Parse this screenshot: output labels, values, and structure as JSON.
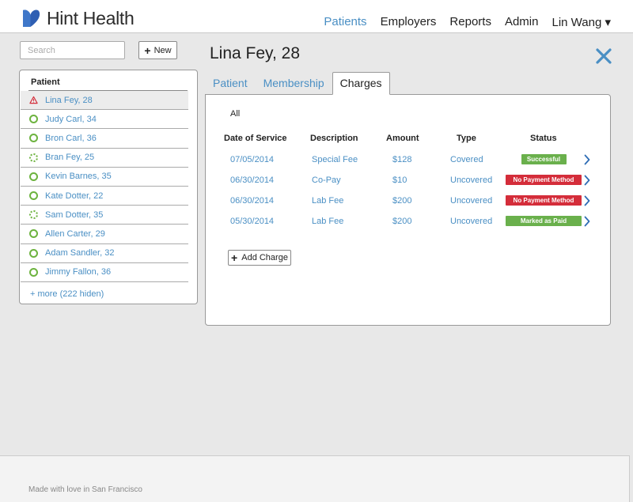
{
  "app": {
    "name": "Hint Health"
  },
  "nav": {
    "items": [
      {
        "label": "Patients",
        "active": true
      },
      {
        "label": "Employers",
        "active": false
      },
      {
        "label": "Reports",
        "active": false
      },
      {
        "label": "Admin",
        "active": false
      }
    ],
    "user_label": "Lin Wang ▾"
  },
  "sidebar": {
    "search_placeholder": "Search",
    "new_label": "New",
    "header": "Patient",
    "patients": [
      {
        "label": "Lina Fey, 28",
        "status": "warning",
        "selected": true
      },
      {
        "label": "Judy Carl, 34",
        "status": "ok"
      },
      {
        "label": "Bron Carl, 36",
        "status": "ok"
      },
      {
        "label": "Bran Fey, 25",
        "status": "pending"
      },
      {
        "label": "Kevin Barnes, 35",
        "status": "ok"
      },
      {
        "label": "Kate Dotter, 22",
        "status": "ok"
      },
      {
        "label": "Sam Dotter, 35",
        "status": "pending"
      },
      {
        "label": "Allen Carter, 29",
        "status": "ok"
      },
      {
        "label": "Adam Sandler, 32",
        "status": "ok"
      },
      {
        "label": "Jimmy Fallon, 36",
        "status": "ok"
      }
    ],
    "more_label": "+ more (222 hiden)"
  },
  "main": {
    "title": "Lina Fey, 28",
    "tabs": [
      {
        "label": "Patient",
        "active": false
      },
      {
        "label": "Membership",
        "active": false
      },
      {
        "label": "Charges",
        "active": true
      }
    ],
    "filter_label": "All",
    "table": {
      "headers": [
        "Date of Service",
        "Description",
        "Amount",
        "Type",
        "Status"
      ],
      "rows": [
        {
          "date": "07/05/2014",
          "description": "Special Fee",
          "amount": "$128",
          "type": "Covered",
          "status": "Successful",
          "status_color": "#6ab04c"
        },
        {
          "date": "06/30/2014",
          "description": "Co-Pay",
          "amount": "$10",
          "type": "Uncovered",
          "status": "No Payment Method",
          "status_color": "#d42d3a"
        },
        {
          "date": "06/30/2014",
          "description": "Lab Fee",
          "amount": "$200",
          "type": "Uncovered",
          "status": "No Payment Method",
          "status_color": "#d42d3a"
        },
        {
          "date": "05/30/2014",
          "description": "Lab Fee",
          "amount": "$200",
          "type": "Uncovered",
          "status": "Marked as Paid",
          "status_color": "#6ab04c"
        }
      ]
    },
    "add_charge_label": "Add Charge"
  },
  "footer": {
    "text": "Made with love in San Francisco"
  },
  "colors": {
    "accent": "#4a8fc4",
    "success": "#6ab04c",
    "danger": "#d42d3a",
    "ok_ring": "#6db33f"
  }
}
